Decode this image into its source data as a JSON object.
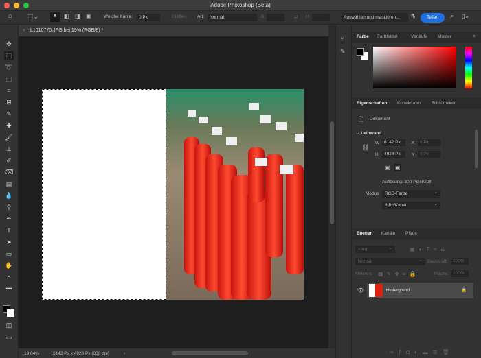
{
  "window": {
    "title": "Adobe Photoshop (Beta)"
  },
  "options": {
    "feather_label": "Weiche Kante:",
    "feather_value": "0 Px",
    "antialias_label": "Glätten",
    "style_label": "Art:",
    "style_value": "Normal",
    "width_label": "B:",
    "height_label": "H:",
    "select_mask": "Auswählen und maskieren...",
    "share": "Teilen"
  },
  "document": {
    "tab_title": "L1010770.JPG bei 19% (RGB/8) *",
    "zoom": "19,04%",
    "info": "6142 Px x 4928 Px (300 ppi)"
  },
  "color_panel": {
    "tabs": [
      "Farbe",
      "Farbfelder",
      "Verläufe",
      "Muster"
    ]
  },
  "properties": {
    "tabs": [
      "Eigenschaften",
      "Korrekturen",
      "Bibliotheken"
    ],
    "doc_label": "Dokument",
    "section": "Leinwand",
    "w_label": "W",
    "w_value": "6142 Px",
    "h_label": "H",
    "h_value": "4928 Px",
    "x_label": "X",
    "x_value": "0 Px",
    "y_label": "Y",
    "y_value": "0 Px",
    "resolution": "Auflösung: 300 Pixel/Zoll",
    "mode_label": "Modus",
    "mode_value": "RGB-Farbe",
    "depth_value": "8 Bit/Kanal"
  },
  "layers": {
    "tabs": [
      "Ebenen",
      "Kanäle",
      "Pfade"
    ],
    "filter": "Art",
    "blend": "Normal",
    "opacity_label": "Deckkraft:",
    "opacity_value": "100%",
    "lock_label": "Fixieren:",
    "fill_label": "Fläche:",
    "fill_value": "100%",
    "items": [
      {
        "name": "Hintergrund",
        "visible": true,
        "locked": true
      }
    ]
  },
  "colors": {
    "accent": "#1f6fe0",
    "foreground": "#000000",
    "background": "#ffffff"
  }
}
